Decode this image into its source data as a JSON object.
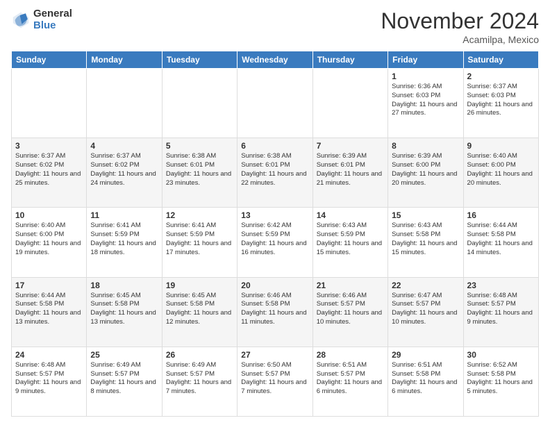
{
  "logo": {
    "general": "General",
    "blue": "Blue"
  },
  "header": {
    "month": "November 2024",
    "location": "Acamilpa, Mexico"
  },
  "weekdays": [
    "Sunday",
    "Monday",
    "Tuesday",
    "Wednesday",
    "Thursday",
    "Friday",
    "Saturday"
  ],
  "weeks": [
    [
      {
        "day": "",
        "info": ""
      },
      {
        "day": "",
        "info": ""
      },
      {
        "day": "",
        "info": ""
      },
      {
        "day": "",
        "info": ""
      },
      {
        "day": "",
        "info": ""
      },
      {
        "day": "1",
        "info": "Sunrise: 6:36 AM\nSunset: 6:03 PM\nDaylight: 11 hours and 27 minutes."
      },
      {
        "day": "2",
        "info": "Sunrise: 6:37 AM\nSunset: 6:03 PM\nDaylight: 11 hours and 26 minutes."
      }
    ],
    [
      {
        "day": "3",
        "info": "Sunrise: 6:37 AM\nSunset: 6:02 PM\nDaylight: 11 hours and 25 minutes."
      },
      {
        "day": "4",
        "info": "Sunrise: 6:37 AM\nSunset: 6:02 PM\nDaylight: 11 hours and 24 minutes."
      },
      {
        "day": "5",
        "info": "Sunrise: 6:38 AM\nSunset: 6:01 PM\nDaylight: 11 hours and 23 minutes."
      },
      {
        "day": "6",
        "info": "Sunrise: 6:38 AM\nSunset: 6:01 PM\nDaylight: 11 hours and 22 minutes."
      },
      {
        "day": "7",
        "info": "Sunrise: 6:39 AM\nSunset: 6:01 PM\nDaylight: 11 hours and 21 minutes."
      },
      {
        "day": "8",
        "info": "Sunrise: 6:39 AM\nSunset: 6:00 PM\nDaylight: 11 hours and 20 minutes."
      },
      {
        "day": "9",
        "info": "Sunrise: 6:40 AM\nSunset: 6:00 PM\nDaylight: 11 hours and 20 minutes."
      }
    ],
    [
      {
        "day": "10",
        "info": "Sunrise: 6:40 AM\nSunset: 6:00 PM\nDaylight: 11 hours and 19 minutes."
      },
      {
        "day": "11",
        "info": "Sunrise: 6:41 AM\nSunset: 5:59 PM\nDaylight: 11 hours and 18 minutes."
      },
      {
        "day": "12",
        "info": "Sunrise: 6:41 AM\nSunset: 5:59 PM\nDaylight: 11 hours and 17 minutes."
      },
      {
        "day": "13",
        "info": "Sunrise: 6:42 AM\nSunset: 5:59 PM\nDaylight: 11 hours and 16 minutes."
      },
      {
        "day": "14",
        "info": "Sunrise: 6:43 AM\nSunset: 5:59 PM\nDaylight: 11 hours and 15 minutes."
      },
      {
        "day": "15",
        "info": "Sunrise: 6:43 AM\nSunset: 5:58 PM\nDaylight: 11 hours and 15 minutes."
      },
      {
        "day": "16",
        "info": "Sunrise: 6:44 AM\nSunset: 5:58 PM\nDaylight: 11 hours and 14 minutes."
      }
    ],
    [
      {
        "day": "17",
        "info": "Sunrise: 6:44 AM\nSunset: 5:58 PM\nDaylight: 11 hours and 13 minutes."
      },
      {
        "day": "18",
        "info": "Sunrise: 6:45 AM\nSunset: 5:58 PM\nDaylight: 11 hours and 13 minutes."
      },
      {
        "day": "19",
        "info": "Sunrise: 6:45 AM\nSunset: 5:58 PM\nDaylight: 11 hours and 12 minutes."
      },
      {
        "day": "20",
        "info": "Sunrise: 6:46 AM\nSunset: 5:58 PM\nDaylight: 11 hours and 11 minutes."
      },
      {
        "day": "21",
        "info": "Sunrise: 6:46 AM\nSunset: 5:57 PM\nDaylight: 11 hours and 10 minutes."
      },
      {
        "day": "22",
        "info": "Sunrise: 6:47 AM\nSunset: 5:57 PM\nDaylight: 11 hours and 10 minutes."
      },
      {
        "day": "23",
        "info": "Sunrise: 6:48 AM\nSunset: 5:57 PM\nDaylight: 11 hours and 9 minutes."
      }
    ],
    [
      {
        "day": "24",
        "info": "Sunrise: 6:48 AM\nSunset: 5:57 PM\nDaylight: 11 hours and 9 minutes."
      },
      {
        "day": "25",
        "info": "Sunrise: 6:49 AM\nSunset: 5:57 PM\nDaylight: 11 hours and 8 minutes."
      },
      {
        "day": "26",
        "info": "Sunrise: 6:49 AM\nSunset: 5:57 PM\nDaylight: 11 hours and 7 minutes."
      },
      {
        "day": "27",
        "info": "Sunrise: 6:50 AM\nSunset: 5:57 PM\nDaylight: 11 hours and 7 minutes."
      },
      {
        "day": "28",
        "info": "Sunrise: 6:51 AM\nSunset: 5:57 PM\nDaylight: 11 hours and 6 minutes."
      },
      {
        "day": "29",
        "info": "Sunrise: 6:51 AM\nSunset: 5:58 PM\nDaylight: 11 hours and 6 minutes."
      },
      {
        "day": "30",
        "info": "Sunrise: 6:52 AM\nSunset: 5:58 PM\nDaylight: 11 hours and 5 minutes."
      }
    ]
  ]
}
